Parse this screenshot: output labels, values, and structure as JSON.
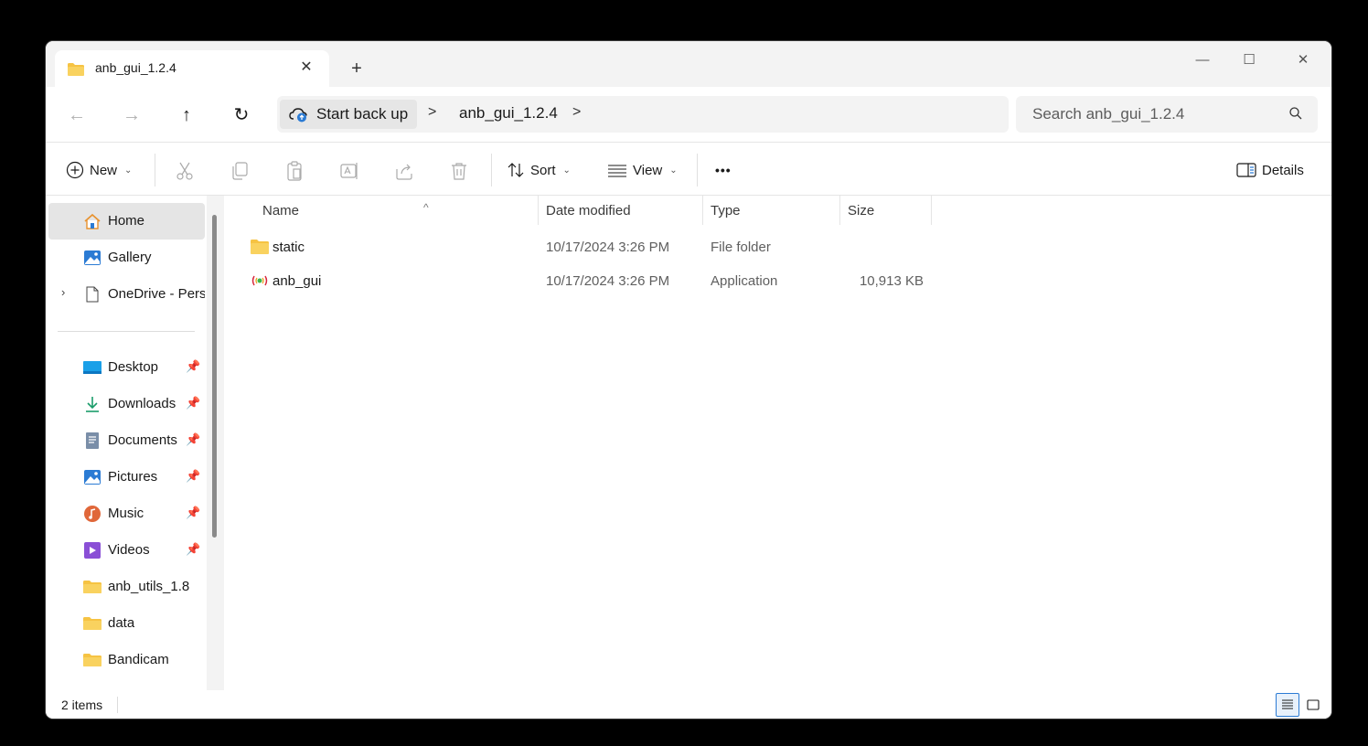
{
  "tab": {
    "title": "anb_gui_1.2.4",
    "close": "✕",
    "new": "+"
  },
  "window_controls": {
    "minimize": "—",
    "maximize": "☐",
    "close": "✕"
  },
  "nav": {
    "back": "←",
    "forward": "→",
    "up": "↑",
    "refresh": "↻"
  },
  "breadcrumb": {
    "backup_label": "Start back up",
    "sep": ">",
    "folder": "anb_gui_1.2.4"
  },
  "search": {
    "placeholder": "Search anb_gui_1.2.4"
  },
  "commandbar": {
    "new_label": "New",
    "sort_label": "Sort",
    "view_label": "View",
    "more_label": "•••",
    "details_label": "Details"
  },
  "sidebar": {
    "items": [
      {
        "label": "Home",
        "icon": "home-icon"
      },
      {
        "label": "Gallery",
        "icon": "gallery-icon"
      },
      {
        "label": "OneDrive - Perso",
        "icon": "document-icon"
      },
      {
        "label": "Desktop",
        "icon": "desktop-icon"
      },
      {
        "label": "Downloads",
        "icon": "download-icon"
      },
      {
        "label": "Documents",
        "icon": "documents-icon"
      },
      {
        "label": "Pictures",
        "icon": "pictures-icon"
      },
      {
        "label": "Music",
        "icon": "music-icon"
      },
      {
        "label": "Videos",
        "icon": "videos-icon"
      },
      {
        "label": "anb_utils_1.8",
        "icon": "folder-icon"
      },
      {
        "label": "data",
        "icon": "folder-icon"
      },
      {
        "label": "Bandicam",
        "icon": "folder-icon"
      }
    ]
  },
  "columns": {
    "name": "Name",
    "date": "Date modified",
    "type": "Type",
    "size": "Size"
  },
  "files": [
    {
      "name": "static",
      "date": "10/17/2024 3:26 PM",
      "type": "File folder",
      "size": ""
    },
    {
      "name": "anb_gui",
      "date": "10/17/2024 3:26 PM",
      "type": "Application",
      "size": "10,913 KB"
    }
  ],
  "status": {
    "items": "2 items"
  },
  "colors": {
    "folder": "#f6c343",
    "accent": "#2b7bd4",
    "selected": "#e5e5e5"
  }
}
